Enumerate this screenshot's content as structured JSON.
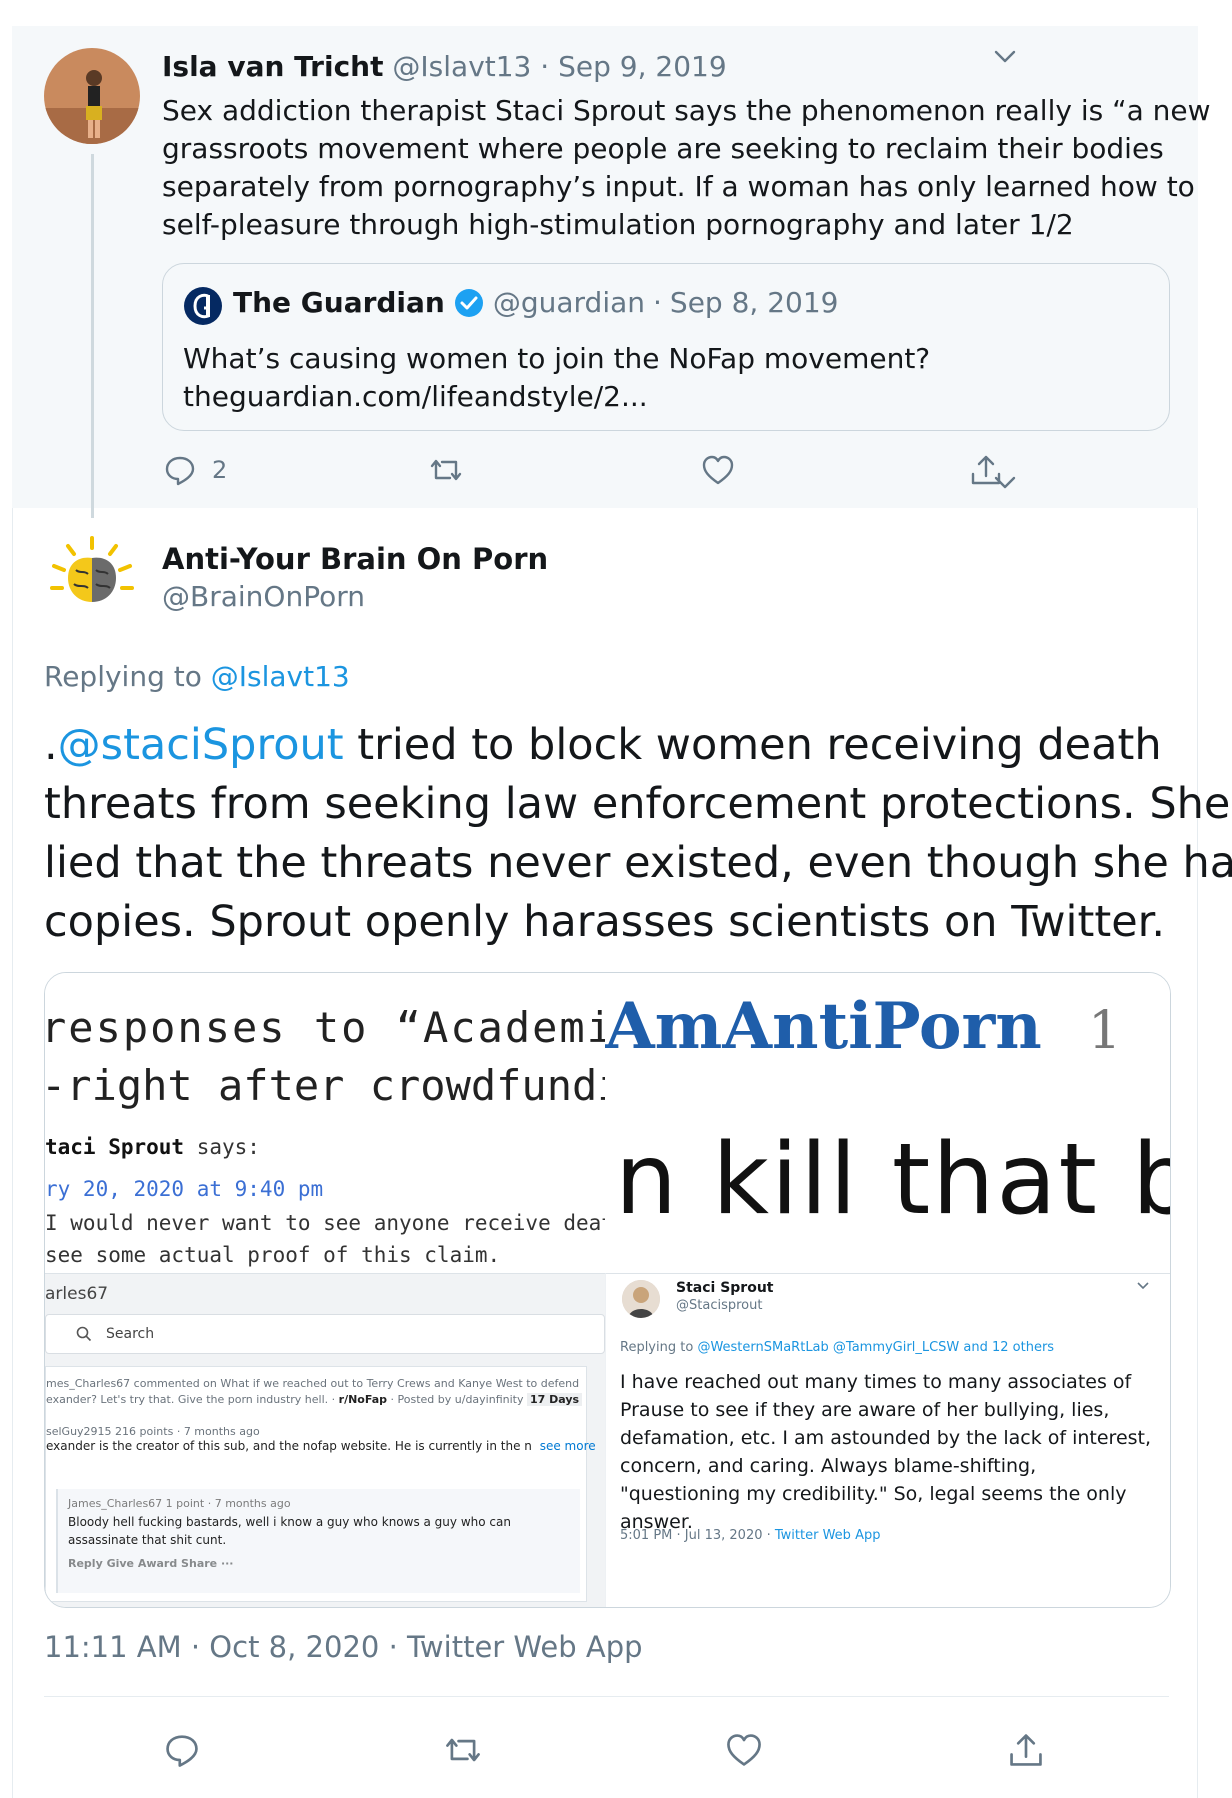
{
  "parent_tweet": {
    "author_name": "Isla van Tricht",
    "handle": "@Islavt13",
    "separator": "·",
    "date": "Sep 9, 2019",
    "text_lines": [
      "Sex addiction therapist Staci Sprout says the phenomenon really is “a new",
      "grassroots movement where people are seeking to reclaim their bodies",
      "separately from pornography’s input. If a woman has only learned how to",
      "self-pleasure through high-stimulation pornography and later 1/2"
    ],
    "quoted": {
      "author_name": "The Guardian",
      "handle": "@guardian",
      "separator": "·",
      "date": "Sep 8, 2019",
      "text_lines": [
        "What’s causing women to join the NoFap movement?",
        "theguardian.com/lifeandstyle/2..."
      ]
    },
    "reply_count": "2"
  },
  "main_tweet": {
    "author_name": "Anti-Your Brain On Porn",
    "handle": "@BrainOnPorn",
    "replying_prefix": "Replying to",
    "replying_to": "@Islavt13",
    "text_prefix": ".",
    "mention": "@staciSprout",
    "text_line1_rest": " tried to block women receiving death",
    "text_lines": [
      "threats from seeking law enforcement protections. She",
      "lied that the threats never existed, even though she had",
      "copies. Sprout openly harasses scientists on Twitter."
    ],
    "timestamp": "11:11 AM · Oct 8, 2020 · Twitter Web App"
  },
  "media": {
    "top_left": {
      "headline1": "responses to “Academi",
      "headline2": "-right after crowdfunding",
      "commenter": "taci Sprout",
      "says": "says:",
      "date": "ry 20, 2020 at 9:40 pm",
      "line1": "I would never want to see anyone receive death th",
      "line2": "see some actual proof of this claim."
    },
    "top_right": {
      "banner": "AmAntiPorn",
      "banner_suffix": "1",
      "kill_text": "n kill that b"
    },
    "bottom_left": {
      "user": "arles67",
      "search_placeholder": "Search",
      "thread_line1": "mes_Charles67 commented on What if we reached out to Terry Crews and Kanye West to defend",
      "thread_line2a": "exander? Let's try that. Give the porn industry hell.  · ",
      "thread_sub": "r/NoFap",
      "thread_line2b": " · Posted by u/dayinfinity ",
      "thread_badge": "17 Days",
      "parent_comment_meta": "selGuy2915 216 points · 7 months ago",
      "parent_comment_text": "exander is the creator of this sub, and the nofap website. He is currently in the n",
      "see_more": "see more",
      "reply_meta": "James_Charles67 1 point · 7 months ago",
      "reply_line1": "Bloody hell fucking bastards, well i know a guy who knows a guy who can",
      "reply_line2": "assassinate that shit cunt.",
      "reply_actions": "Reply  Give Award  Share  ···"
    },
    "bottom_right": {
      "author_name": "Staci Sprout",
      "handle": "@Stacisprout",
      "replying_prefix": "Replying to",
      "replying_to": "@WesternSMaRtLab @TammyGirl_LCSW and 12 others",
      "text_lines": [
        "I have reached out many times to many associates of",
        "Prause to see if they are aware of her bullying, lies,",
        "defamation, etc. I am astounded by the lack of interest,",
        "concern, and caring. Always blame-shifting,",
        "\"questioning my credibility.\" So, legal seems the only",
        "answer."
      ],
      "time": "5:01 PM · Jul 13, 2020 · ",
      "client": "Twitter Web App"
    }
  },
  "icons": {
    "reply": "reply-icon",
    "retweet": "retweet-icon",
    "like": "like-icon",
    "share": "share-icon",
    "caret": "chevron-down-icon",
    "verified": "verified-badge-icon"
  },
  "colors": {
    "link_blue": "#1b95e0",
    "muted_gray": "#657786",
    "parent_bg": "#f5f8fa",
    "guardian_navy": "#052962"
  }
}
